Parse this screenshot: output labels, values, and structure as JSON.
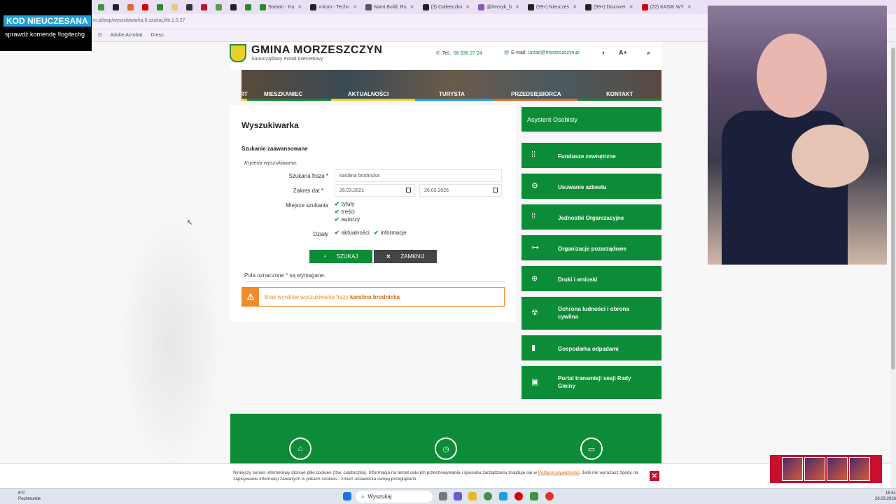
{
  "browser": {
    "tabs": [
      {
        "label": "",
        "color": "#3a9a3a"
      },
      {
        "label": "",
        "color": "#222"
      },
      {
        "label": "",
        "color": "#e06a2a"
      },
      {
        "label": "",
        "color": "#d00"
      },
      {
        "label": "",
        "color": "#2a8a2a"
      },
      {
        "label": "",
        "color": "#e8c87a"
      },
      {
        "label": "",
        "color": "#333"
      },
      {
        "label": "",
        "color": "#c8102e"
      },
      {
        "label": "",
        "color": "#5a9a4a"
      },
      {
        "label": "",
        "color": "#222"
      },
      {
        "label": "",
        "color": "#2a8a2a"
      },
      {
        "label": "Stream - Ku",
        "color": "#2a8a2a"
      },
      {
        "label": "x-kom - Techn",
        "color": "#222"
      },
      {
        "label": "Nami Build, Ru",
        "color": "#555"
      },
      {
        "label": "(3) Calleeczko",
        "color": "#222"
      },
      {
        "label": "@henryk_b",
        "color": "#8a5ab8"
      },
      {
        "label": "(99+) Nieuczes",
        "color": "#222"
      },
      {
        "label": "(99+) Discover",
        "color": "#222"
      },
      {
        "label": "(22) KASIK WY",
        "color": "#d00"
      }
    ],
    "address": "m.pl/asp/wyszukiwarka,0,szukaj,filtr,1,0,27",
    "bookmarks": [
      "Adobe Acrobat",
      "Dress"
    ]
  },
  "overlay": {
    "title": "KOD NIEUCZESANA",
    "subtitle": "sprawdź komendę !logitechg"
  },
  "site": {
    "name": "GMINA MORZESZCZYN",
    "subtitle": "Samorządowy Portal internetowy",
    "phone_label": "Tel.:",
    "phone": "58 536 27 24",
    "email_label": "E-mail:",
    "email": "urzad@morzeszczyn.pl",
    "font_size_label": "A+"
  },
  "nav": {
    "items": [
      "RT",
      "MIESZKANIEC",
      "AKTUALNOŚCI",
      "TURYSTA",
      "PRZEDSIĘBIORCA",
      "KONTAKT"
    ],
    "colors": [
      "#e8d22a",
      "#0c8c36",
      "#e8d22a",
      "#1da1dd",
      "#e06a2a",
      "#0c8c36"
    ]
  },
  "search": {
    "title": "Wyszukiwarka",
    "section": "Szukanie zaawansowane",
    "criteria": "Kryteria wyszukiwania.",
    "phrase_label": "Szukana fraza *",
    "phrase_value": "karolina brodnicka",
    "date_label": "Zakres dat *",
    "date_from": "26.03.2021",
    "date_to": "26.03.2026",
    "place_label": "Miejsce szukania",
    "places": [
      "tytuły",
      "treści",
      "autorzy"
    ],
    "sections_label": "Działy",
    "sections": [
      "aktualności",
      "informacje"
    ],
    "search_button": "SZUKAJ",
    "close_button": "ZAMKNIJ",
    "required_note": "Pola oznaczone * są wymagane.",
    "alert_prefix": "Brak wyników wyszukiwania frazy",
    "alert_phrase": "karolina brodnicka",
    "alert_suffix": "."
  },
  "sidebar": {
    "header": "Asystent Osobisty",
    "items": [
      {
        "label": "Fundusze zewnętrzne",
        "icon": "grid-dots-icon"
      },
      {
        "label": "Usuwanie azbestu",
        "icon": "gears-icon"
      },
      {
        "label": "Jednostki Organizacyjne",
        "icon": "grid-dots-icon"
      },
      {
        "label": "Organizacje pozarządowe",
        "icon": "network-icon"
      },
      {
        "label": "Druki i wnioski",
        "icon": "circle-arrow-icon"
      },
      {
        "label": "Ochrona ludności i obrona cywilna",
        "icon": "hazard-icon"
      },
      {
        "label": "Gospodarka odpadami",
        "icon": "trash-icon"
      },
      {
        "label": "Portal transmisji sesji Rady Gminy",
        "icon": "video-icon"
      }
    ]
  },
  "cookie": {
    "text_before": "Niniejszy serwis internetowy stosuje pliki cookies (tzw. ciasteczka). Informacja na temat celu ich przechowywania i sposobu zarządzania znajduje się w",
    "link": "Polityce prywatności",
    "text_after": ". Jeśli nie wyrażasz zgody na zapisywanie informacji zawartych w plikach cookies - zmień ustawienia swojej przeglądarki."
  },
  "taskbar": {
    "temperature": "8°C",
    "weather": "Pochmurnie",
    "search_label": "Wyszukaj",
    "time": "15:51",
    "date": "26.03.2026"
  }
}
